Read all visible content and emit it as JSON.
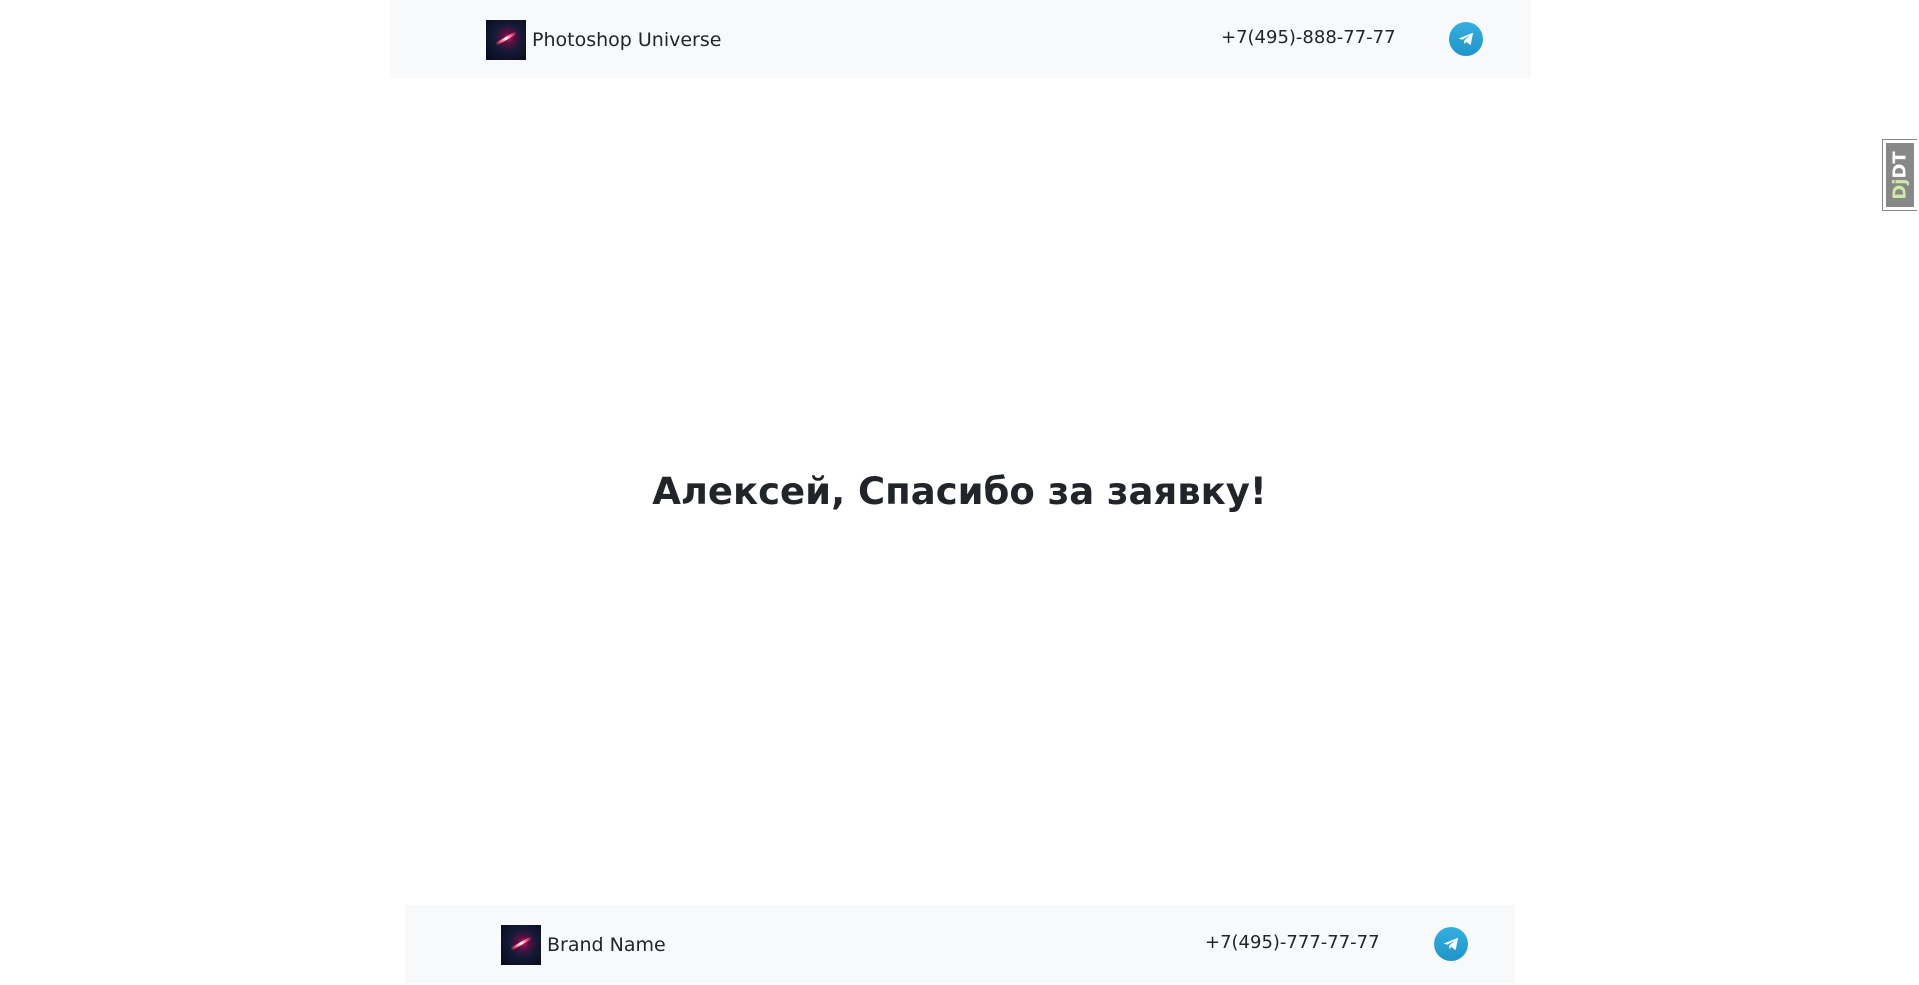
{
  "header": {
    "brand_name": "Photoshop Universe",
    "phone": "+7(495)-888-77-77"
  },
  "main": {
    "message": "Алексей, Спасибо за заявку!"
  },
  "footer": {
    "brand_name": "Brand Name",
    "phone": "+7(495)-777-77-77"
  },
  "debug_toolbar": {
    "prefix": "Dj",
    "suffix": "DT"
  },
  "colors": {
    "navbar_bg": "#f8f9fa",
    "telegram": "#2aa3d8",
    "text": "#212529"
  },
  "icons": {
    "logo": "galaxy-logo-icon",
    "telegram": "telegram-icon"
  }
}
